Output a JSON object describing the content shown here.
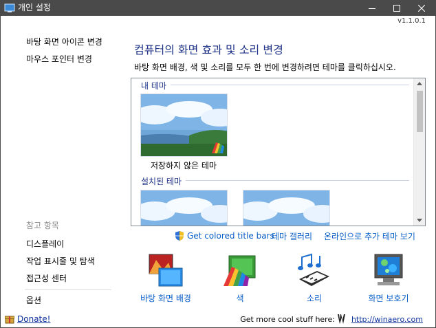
{
  "window": {
    "title": "개인 설정",
    "version": "v1.1.0.1"
  },
  "sidebar": {
    "tasks": [
      {
        "label": "바탕 화면 아이콘 변경"
      },
      {
        "label": "마우스 포인터 변경"
      }
    ],
    "see_also_title": "참고 항목",
    "see_also": [
      {
        "label": "디스플레이"
      },
      {
        "label": "작업 표시줄 및 탐색"
      },
      {
        "label": "접근성 센터"
      }
    ],
    "options_label": "옵션"
  },
  "main": {
    "heading": "컴퓨터의 화면 효과 및 소리 변경",
    "subtext": "바탕 화면 배경, 색 및 소리를 모두 한 번에 변경하려면 테마를 클릭하십시오.",
    "groups": {
      "my_themes": "내 테마",
      "unsaved_theme": "저장하지 않은 테마",
      "installed_themes": "설치된 테마"
    },
    "links": {
      "colored_title_bars": "Get colored title bars",
      "theme_gallery": "테마 갤러리",
      "more_online": "온라인으로 추가 테마 보기"
    },
    "tiles": [
      {
        "label": "바탕 화면 배경"
      },
      {
        "label": "색"
      },
      {
        "label": "소리"
      },
      {
        "label": "화면 보호기"
      }
    ]
  },
  "footer": {
    "donate": "Donate!",
    "more_stuff": "Get more cool stuff here:",
    "url": "http://winaero.com"
  }
}
